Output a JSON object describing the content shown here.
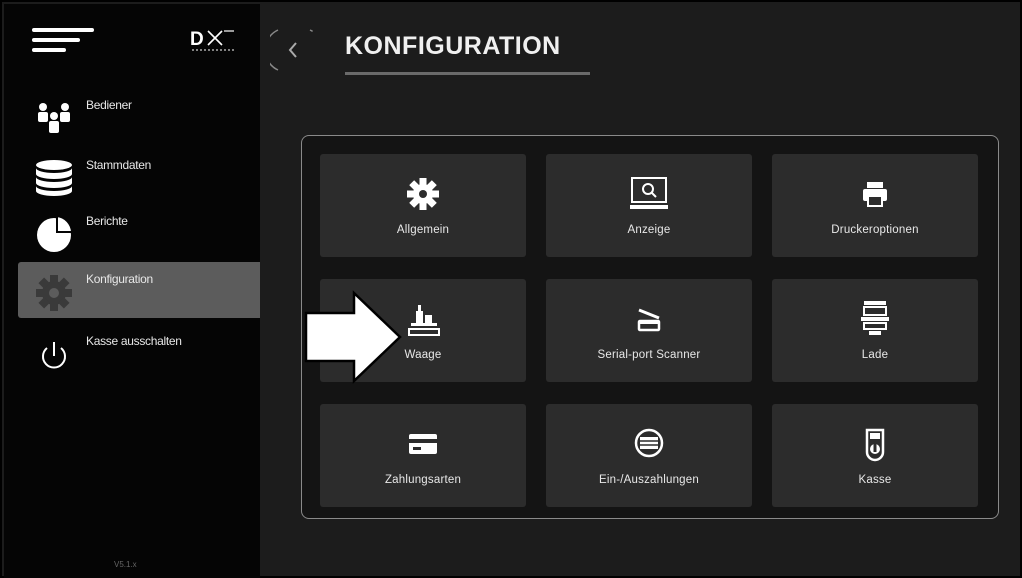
{
  "sidebar": {
    "logo_text": "DX",
    "items": [
      {
        "label": "Bediener",
        "icon": "users-icon",
        "active": false
      },
      {
        "label": "Stammdaten",
        "icon": "database-icon",
        "active": false
      },
      {
        "label": "Berichte",
        "icon": "pie-chart-icon",
        "active": false
      },
      {
        "label": "Konfiguration",
        "icon": "gear-icon",
        "active": true
      },
      {
        "label": "Kasse ausschalten",
        "icon": "power-icon",
        "active": false
      }
    ],
    "version": "V5.1.x"
  },
  "header": {
    "title": "KONFIGURATION",
    "back_icon": "chevron-left-icon"
  },
  "tiles": [
    {
      "label": "Allgemein",
      "icon": "gear-icon"
    },
    {
      "label": "Anzeige",
      "icon": "monitor-icon"
    },
    {
      "label": "Druckeroptionen",
      "icon": "printer-icon"
    },
    {
      "label": "Waage",
      "icon": "scale-icon"
    },
    {
      "label": "Serial-port Scanner",
      "icon": "scanner-icon"
    },
    {
      "label": "Lade",
      "icon": "cash-drawer-icon"
    },
    {
      "label": "Zahlungsarten",
      "icon": "credit-card-icon"
    },
    {
      "label": "Ein-/Auszahlungen",
      "icon": "cash-exchange-icon"
    },
    {
      "label": "Kasse",
      "icon": "register-icon"
    }
  ],
  "colors": {
    "sidebar_bg": "#050505",
    "content_bg": "#1c1c1c",
    "tile_bg": "#2c2c2c",
    "active_item_bg": "#5c5c5c"
  }
}
